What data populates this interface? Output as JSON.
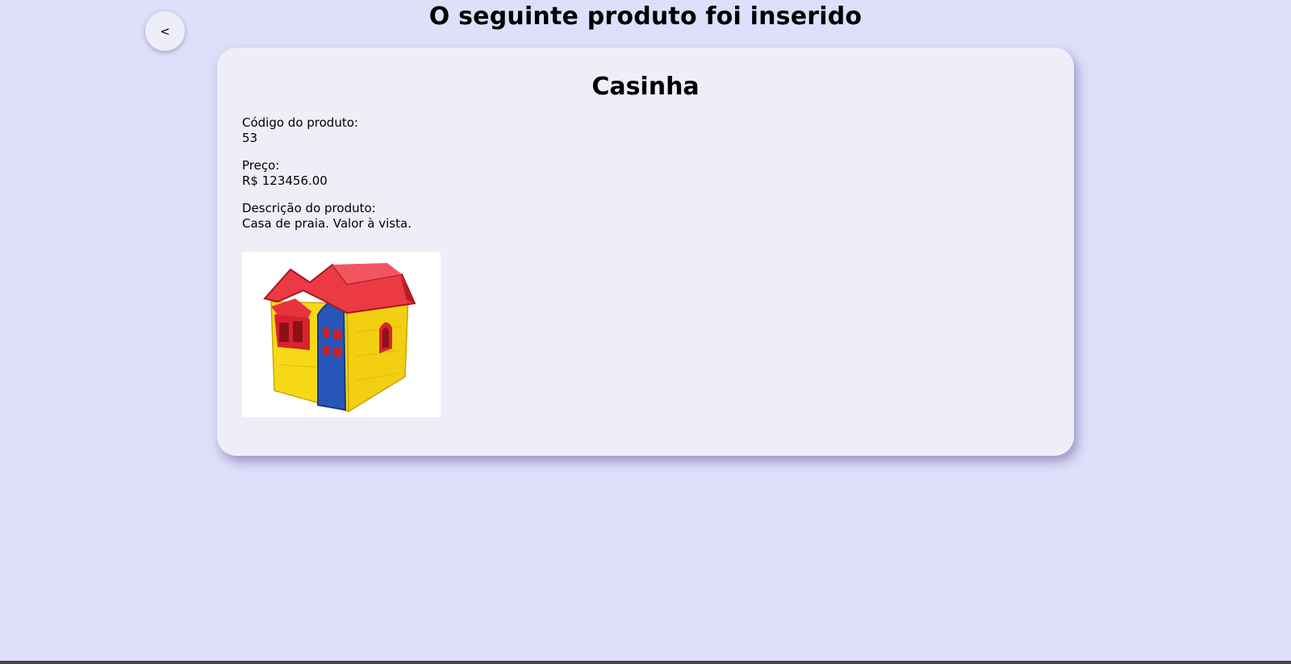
{
  "header": {
    "title": "O seguinte produto foi inserido",
    "back_label": "<"
  },
  "product": {
    "name": "Casinha",
    "code_label": "Código do produto:",
    "code_value": "53",
    "price_label": "Preço:",
    "price_value": "R$ 123456.00",
    "description_label": "Descrição do produto:",
    "description_value": "Casa de praia. Valor à vista."
  },
  "colors": {
    "background": "#dedffa",
    "card": "#eeeef8",
    "roof": "#e8333f",
    "walls": "#f5d416",
    "door": "#2a5cc0"
  }
}
